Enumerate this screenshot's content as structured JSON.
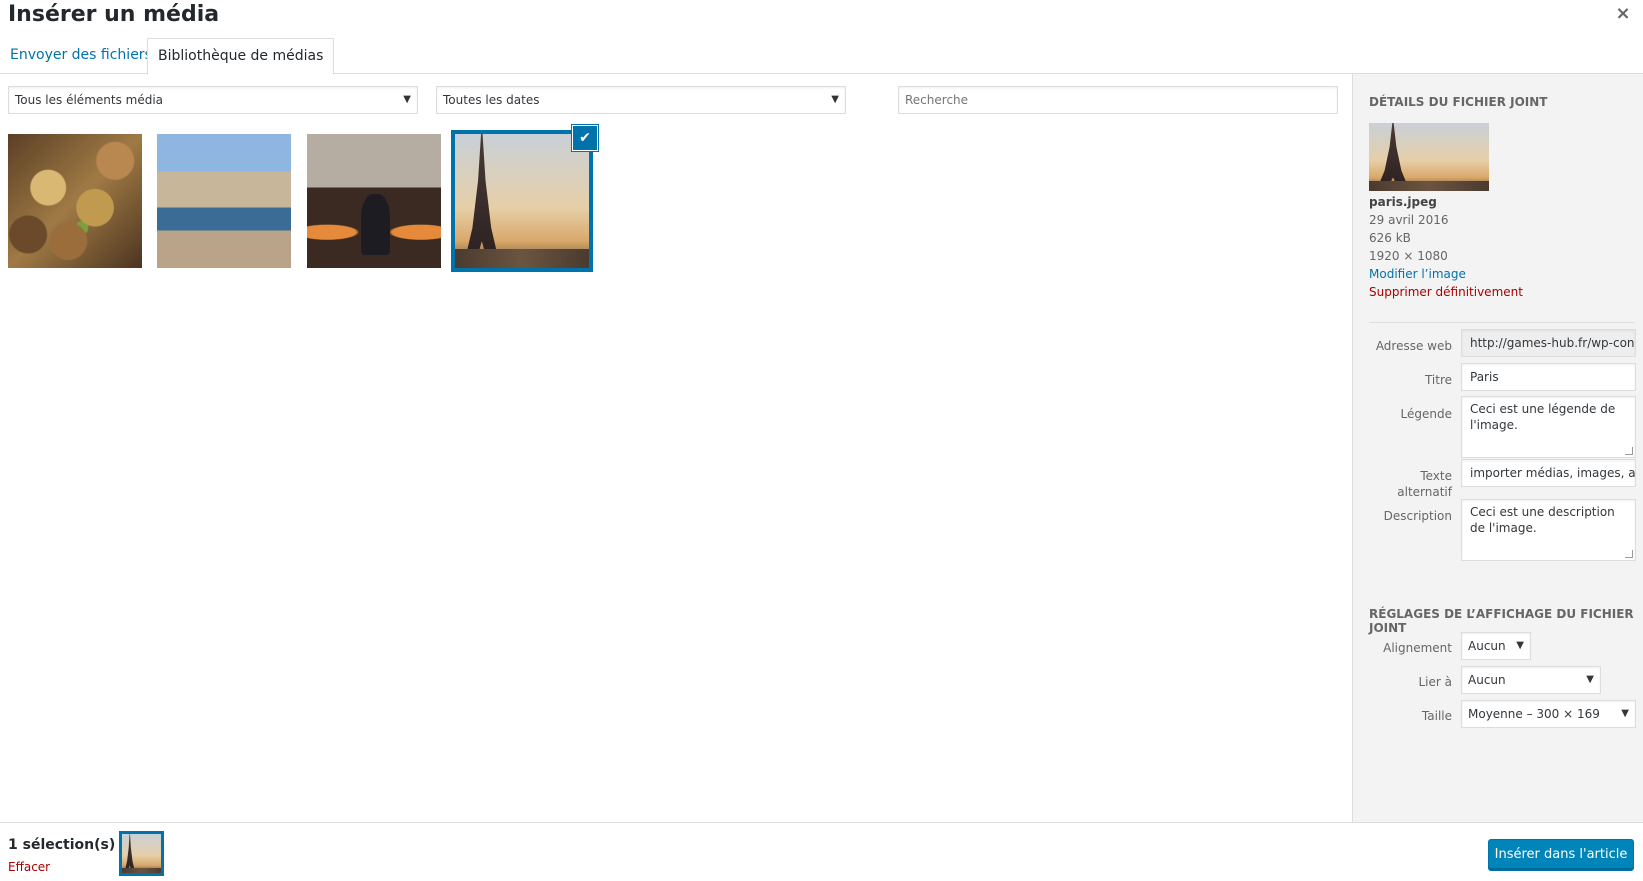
{
  "modal": {
    "title": "Insérer un média",
    "close_icon": "×"
  },
  "tabs": [
    {
      "label": "Envoyer des fichiers"
    },
    {
      "label": "Bibliothèque de médias"
    }
  ],
  "filters": {
    "type": {
      "selected": "Tous les éléments média"
    },
    "date": {
      "selected": "Toutes les dates"
    },
    "search": {
      "placeholder": "Recherche",
      "value": ""
    },
    "dropdown_icon": "▼"
  },
  "library": {
    "items": [
      {
        "image": "locks"
      },
      {
        "image": "marseille"
      },
      {
        "image": "station"
      },
      {
        "image": "paris",
        "selected": true
      }
    ],
    "check_icon": "✔"
  },
  "details": {
    "heading": "Détails du fichier joint",
    "filename": "paris.jpeg",
    "date": "29 avril 2016",
    "size": "626 kB",
    "dimensions": "1920 × 1080",
    "edit_link": "Modifier l’image",
    "delete_link": "Supprimer définitivement",
    "fields": {
      "url_label": "Adresse web",
      "url_value": "http://games-hub.fr/wp-con",
      "title_label": "Titre",
      "title_value": "Paris",
      "caption_label": "Légende",
      "caption_value": "Ceci est une légende de l'image.",
      "alt_label_1": "Texte",
      "alt_label_2": "alternatif",
      "alt_value": "importer médias, images, ar",
      "description_label": "Description",
      "description_value": "Ceci est une description de l'image."
    }
  },
  "display_settings": {
    "heading": "Réglages de l’affichage du fichier joint",
    "alignment_label": "Alignement",
    "alignment_value": "Aucun",
    "link_label": "Lier à",
    "link_value": "Aucun",
    "size_label": "Taille",
    "size_value": "Moyenne – 300 × 169"
  },
  "toolbar": {
    "selection_count": "1 sélection(s)",
    "clear_label": "Effacer",
    "insert_button": "Insérer dans l'article"
  },
  "colors": {
    "accent": "#0073aa",
    "danger": "#aa0000",
    "button": "#0085ba"
  }
}
